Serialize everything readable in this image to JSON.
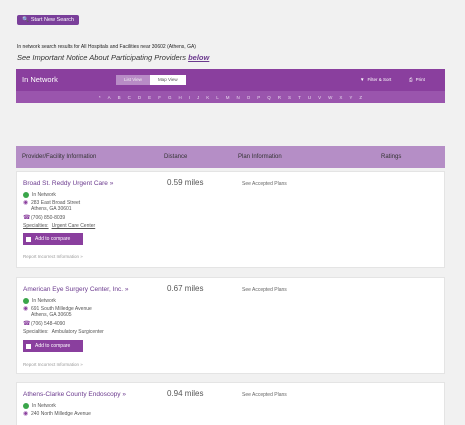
{
  "new_search": {
    "label": "Start New Search"
  },
  "results_line": "In network search results for All Hospitals and Facilities near 30602 (Athens, GA)",
  "notice": {
    "text": "See Important Notice About Participating Providers ",
    "link": "below"
  },
  "header": {
    "title": "In Network",
    "list_view": "List View",
    "map_view": "Map View",
    "filter_sort": "Filter & Sort",
    "print": "Print"
  },
  "alphabet": [
    "*",
    "A",
    "B",
    "C",
    "D",
    "E",
    "F",
    "G",
    "H",
    "I",
    "J",
    "K",
    "L",
    "M",
    "N",
    "O",
    "P",
    "Q",
    "R",
    "S",
    "T",
    "U",
    "V",
    "W",
    "X",
    "Y",
    "Z"
  ],
  "columns": {
    "provider": "Provider/Facility Information",
    "distance": "Distance",
    "plan": "Plan Information",
    "ratings": "Ratings"
  },
  "cards": [
    {
      "name": "Broad St. Reddy Urgent Care »",
      "distance": "0.59 miles",
      "plans": "See Accepted Plans",
      "network": "In Network",
      "address1": "283 East Broad Street",
      "address2": "Athens, GA 30601",
      "phone": "(706) 850-8039",
      "specialty_label": "Specialties:",
      "specialty": "Urgent Care Center",
      "compare": "Add to compare",
      "report": "Report Incorrect Information »"
    },
    {
      "name": "American Eye Surgery Center, Inc. »",
      "distance": "0.67 miles",
      "plans": "See Accepted Plans",
      "network": "In Network",
      "address1": "691 South Milledge Avenue",
      "address2": "Athens, GA 30605",
      "phone": "(706) 548-4090",
      "specialty_label": "Specialties:",
      "specialty": "Ambulatory Surgicenter",
      "compare": "Add to compare",
      "report": "Report Incorrect Information »"
    },
    {
      "name": "Athens-Clarke County Endoscopy »",
      "distance": "0.94 miles",
      "plans": "See Accepted Plans",
      "network": "In Network",
      "address1": "240 North Milledge Avenue"
    }
  ],
  "colors": {
    "purple": "#8a3f9e",
    "green": "#3aa64a"
  }
}
